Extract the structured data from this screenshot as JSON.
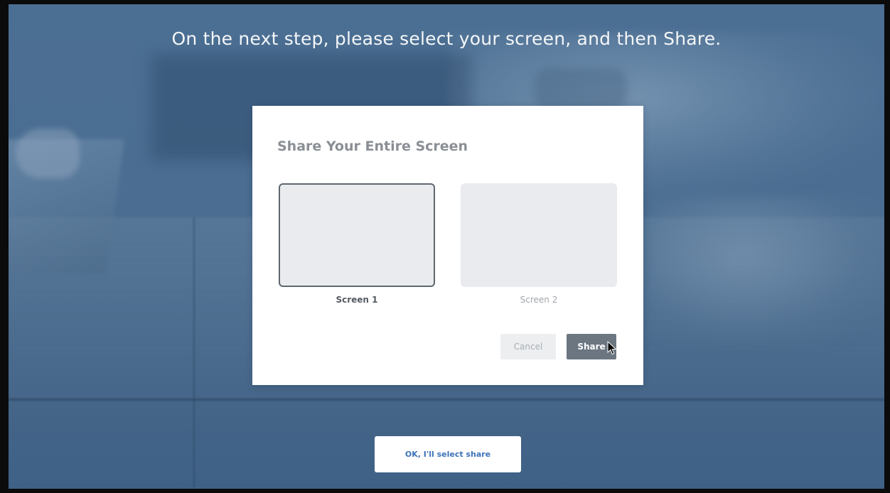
{
  "headline": "On the next step, please select your screen, and then Share.",
  "dialog": {
    "title": "Share Your Entire Screen",
    "screens": [
      {
        "label": "Screen 1",
        "selected": true
      },
      {
        "label": "Screen 2",
        "selected": false
      }
    ],
    "cancel_label": "Cancel",
    "share_label": "Share"
  },
  "ok_button_label": "OK, I'll select share",
  "colors": {
    "overlay_blue": "#4a6c90",
    "share_button": "#6b7681",
    "ok_text": "#3d72b8"
  }
}
